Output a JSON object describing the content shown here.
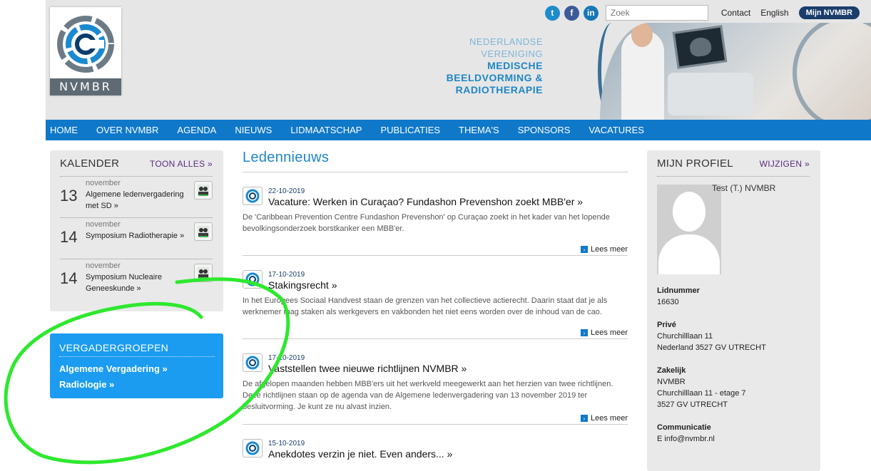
{
  "logo": {
    "text": "NVMBR"
  },
  "tagline": {
    "line1": "NEDERLANDSE",
    "line2": "VERENIGING",
    "line3": "MEDISCHE",
    "line4": "BEELDVORMING &",
    "line5": "RADIOTHERAPIE"
  },
  "topbar": {
    "search_placeholder": "Zoek",
    "contact": "Contact",
    "english": "English",
    "mijn": "Mijn NVMBR"
  },
  "nav": [
    "HOME",
    "OVER NVMBR",
    "AGENDA",
    "NIEUWS",
    "LIDMAATSCHAP",
    "PUBLICATIES",
    "THEMA'S",
    "SPONSORS",
    "VACATURES"
  ],
  "kalender": {
    "title": "KALENDER",
    "link": "TOON ALLES »",
    "events": [
      {
        "day": "13",
        "month": "november",
        "title": "Algemene ledenvergadering met SD »"
      },
      {
        "day": "14",
        "month": "november",
        "title": "Symposium Radiotherapie »"
      },
      {
        "day": "14",
        "month": "november",
        "title": "Symposium Nucleaire Geneeskunde »"
      }
    ]
  },
  "vergadergroepen": {
    "title": "VERGADERGROEPEN",
    "links": [
      "Algemene Vergadering »",
      "Radiologie »"
    ]
  },
  "ledennieuws": {
    "title": "Ledennieuws",
    "items": [
      {
        "date": "22-10-2019",
        "title": "Vacature: Werken in Curaçao? Fundashon Prevenshon zoekt MBB'er »",
        "body": "De 'Caribbean Prevention Centre Fundashon Prevenshon' op Curaçao zoekt in het kader van het lopende bevolkingsonderzoek borstkanker een MBB'er.",
        "more": "Lees meer"
      },
      {
        "date": "17-10-2019",
        "title": "Stakingsrecht »",
        "body": "In het Europees Sociaal Handvest staan de grenzen van het collectieve actierecht. Daarin staat dat je als werknemer mag staken als werkgevers en vakbonden het niet eens worden over de inhoud van de cao.",
        "more": "Lees meer"
      },
      {
        "date": "17-10-2019",
        "title": "Vaststellen twee nieuwe richtlijnen NVMBR »",
        "body": "De afgelopen maanden hebben MBB'ers uit het werkveld meegewerkt aan het herzien van twee richtlijnen. Deze richtlijnen staan op de agenda van de Algemene ledenvergadering van 13 november 2019 ter besluitvorming. Je kunt ze nu alvast inzien.",
        "more": "Lees meer"
      },
      {
        "date": "15-10-2019",
        "title": "Anekdotes verzin je niet. Even anders... »",
        "body": "",
        "more": ""
      }
    ]
  },
  "profiel": {
    "title": "MIJN PROFIEL",
    "link": "WIJZIGEN »",
    "name": "Test (T.) NVMBR",
    "lidnummer_label": "Lidnummer",
    "lidnummer": "16630",
    "prive_label": "Privé",
    "prive_line1": "Churchilllaan 11",
    "prive_line2": "Nederland 3527 GV UTRECHT",
    "zakelijk_label": "Zakelijk",
    "zakelijk_line1": "NVMBR",
    "zakelijk_line2": "Churchilllaan 11 - etage 7",
    "zakelijk_line3": "3527 GV UTRECHT",
    "communicatie_label": "Communicatie",
    "communicatie_line1": "E info@nvmbr.nl"
  },
  "colors": {
    "nav_blue": "#0f78c9",
    "verg_blue": "#1b9cf0",
    "title_blue": "#1f86c7",
    "annotation_green": "#2ee82e"
  }
}
